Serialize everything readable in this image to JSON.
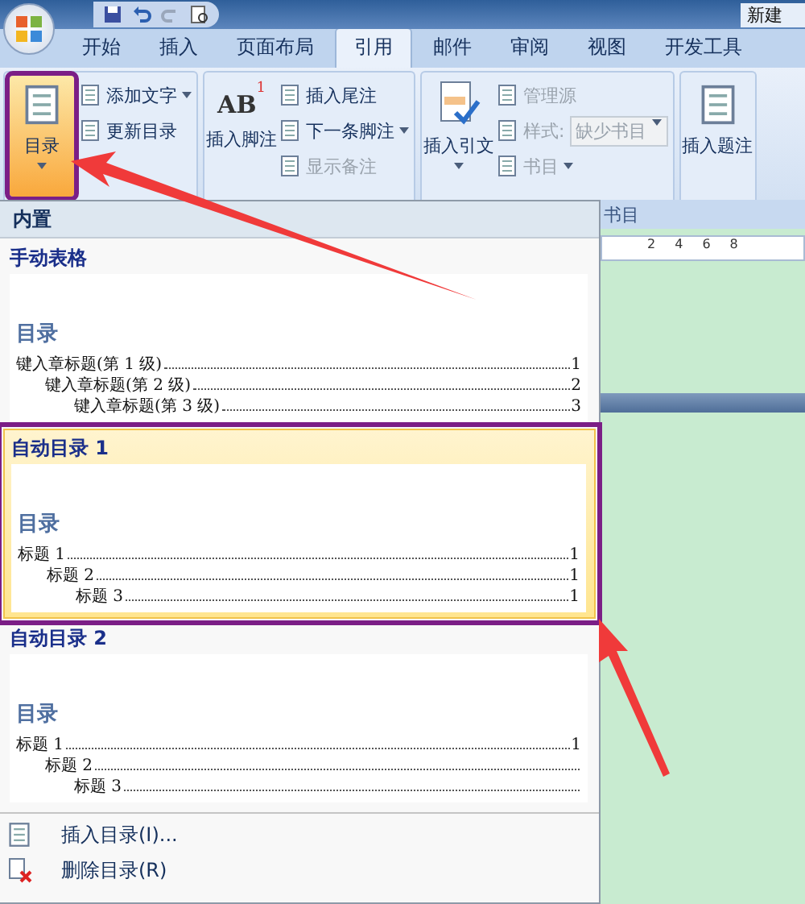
{
  "title_bar": {
    "title": "新建"
  },
  "tabs": [
    {
      "label": "开始",
      "selected": false
    },
    {
      "label": "插入",
      "selected": false
    },
    {
      "label": "页面布局",
      "selected": false
    },
    {
      "label": "引用",
      "selected": true
    },
    {
      "label": "邮件",
      "selected": false
    },
    {
      "label": "审阅",
      "selected": false
    },
    {
      "label": "视图",
      "selected": false
    },
    {
      "label": "开发工具",
      "selected": false
    }
  ],
  "ribbon": {
    "groups": [
      {
        "big": {
          "label": "目录",
          "pressed": true,
          "dropdown": true
        },
        "small": [
          {
            "kind": "button",
            "label": "添加文字",
            "dropdown": true,
            "disabled": false
          },
          {
            "kind": "button",
            "label": "更新目录",
            "dropdown": false,
            "disabled": false
          }
        ]
      },
      {
        "big": {
          "label": "插入脚注",
          "pressed": false,
          "dropdown": false,
          "icon_text": "AB",
          "icon_superscript": "1"
        },
        "small": [
          {
            "kind": "button",
            "label": "插入尾注",
            "dropdown": false,
            "disabled": false
          },
          {
            "kind": "button",
            "label": "下一条脚注",
            "dropdown": true,
            "disabled": false
          },
          {
            "kind": "button",
            "label": "显示备注",
            "dropdown": false,
            "disabled": true
          }
        ]
      },
      {
        "big": {
          "label": "插入引文",
          "pressed": false,
          "dropdown": true
        },
        "small": [
          {
            "kind": "button",
            "label": "管理源",
            "dropdown": false,
            "disabled": true
          },
          {
            "kind": "combo",
            "label": "样式:",
            "value": "缺少书目",
            "dropdown": true,
            "disabled": true
          },
          {
            "kind": "button",
            "label": "书目",
            "dropdown": true,
            "disabled": true
          }
        ]
      },
      {
        "big": {
          "label": "插入题注",
          "pressed": false,
          "dropdown": false
        }
      }
    ],
    "visible_group_label": "书目"
  },
  "toc_menu": {
    "header": "内置",
    "galleries": [
      {
        "title": "手动表格",
        "selected": false,
        "preview": {
          "heading": "目录",
          "entries": [
            {
              "text": "键入章标题(第 1 级)",
              "page": "1",
              "children": [
                {
                  "text": "键入章标题(第 2 级)",
                  "page": "2",
                  "children": [
                    {
                      "text": "键入章标题(第 3 级)",
                      "page": "3"
                    }
                  ]
                }
              ]
            }
          ]
        }
      },
      {
        "title": "自动目录 1",
        "selected": true,
        "preview": {
          "heading": "目录",
          "entries": [
            {
              "text": "标题 1",
              "page": "1",
              "children": [
                {
                  "text": "标题 2",
                  "page": "1",
                  "children": [
                    {
                      "text": "标题 3",
                      "page": "1"
                    }
                  ]
                }
              ]
            }
          ]
        }
      },
      {
        "title": "自动目录 2",
        "selected": false,
        "preview": {
          "heading": "目录",
          "entries": [
            {
              "text": "标题 1",
              "page": "1",
              "children": [
                {
                  "text": "标题 2",
                  "children": [
                    {
                      "text": "标题 3"
                    }
                  ]
                }
              ]
            }
          ]
        }
      }
    ],
    "commands": [
      {
        "kind": "insert",
        "label": "插入目录(I)..."
      },
      {
        "kind": "remove",
        "label": "删除目录(R)"
      }
    ]
  },
  "ruler": {
    "numbers": [
      "2",
      "4",
      "6",
      "8"
    ]
  }
}
